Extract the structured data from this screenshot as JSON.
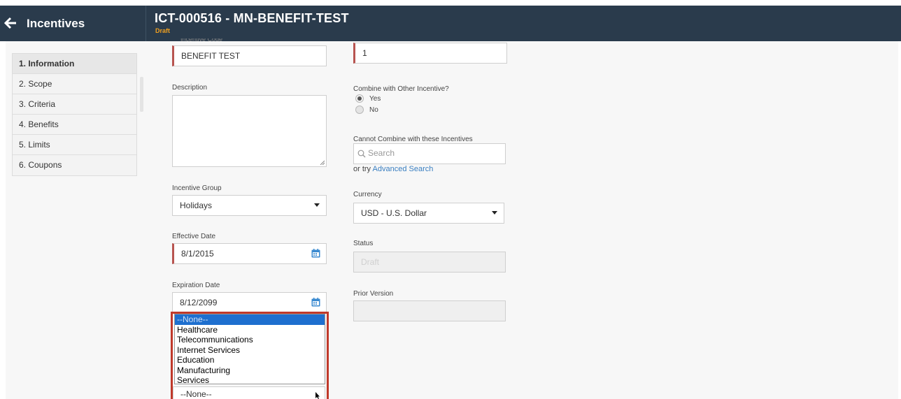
{
  "header": {
    "app_title": "Incentives",
    "record_title": "ICT-000516 - MN-BENEFIT-TEST",
    "record_status": "Draft",
    "header_color": "#2a3b4c"
  },
  "nav": {
    "steps": [
      {
        "label": "1. Information",
        "active": true
      },
      {
        "label": "2. Scope"
      },
      {
        "label": "3. Criteria"
      },
      {
        "label": "4. Benefits"
      },
      {
        "label": "5. Limits"
      },
      {
        "label": "6. Coupons"
      }
    ]
  },
  "form": {
    "incentive_code": {
      "label": "Incentive Code",
      "value": "BENEFIT TEST"
    },
    "priority": {
      "value": "1"
    },
    "description": {
      "label": "Description",
      "value": ""
    },
    "combine": {
      "label": "Combine with Other Incentive?",
      "options": [
        "Yes",
        "No"
      ],
      "selected": "Yes"
    },
    "cannot_combine": {
      "label": "Cannot Combine with these Incentives",
      "placeholder": "Search",
      "or_try": "or try",
      "advanced_link": "Advanced Search"
    },
    "incentive_group": {
      "label": "Incentive Group",
      "value": "Holidays"
    },
    "currency": {
      "label": "Currency",
      "value": "USD - U.S. Dollar"
    },
    "effective_date": {
      "label": "Effective Date",
      "value": "8/1/2015"
    },
    "status": {
      "label": "Status",
      "value": "Draft"
    },
    "expiration_date": {
      "label": "Expiration Date",
      "value": "8/12/2099"
    },
    "prior_version": {
      "label": "Prior Version",
      "value": ""
    },
    "industry": {
      "value": "--None--",
      "options": [
        "--None--",
        "Healthcare",
        "Telecommunications",
        "Internet Services",
        "Education",
        "Manufacturing",
        "Services"
      ],
      "selected_index": 0
    }
  },
  "colors": {
    "required_marker": "#b85450",
    "link": "#3a7fc1",
    "status_draft": "#f0a020",
    "highlight_box": "#c0392b",
    "dropdown_selected": "#1e6fcf"
  },
  "icons": {
    "back": "back-arrow-icon",
    "calendar": "calendar-icon",
    "search": "search-icon",
    "cursor": "mouse-cursor-icon"
  }
}
